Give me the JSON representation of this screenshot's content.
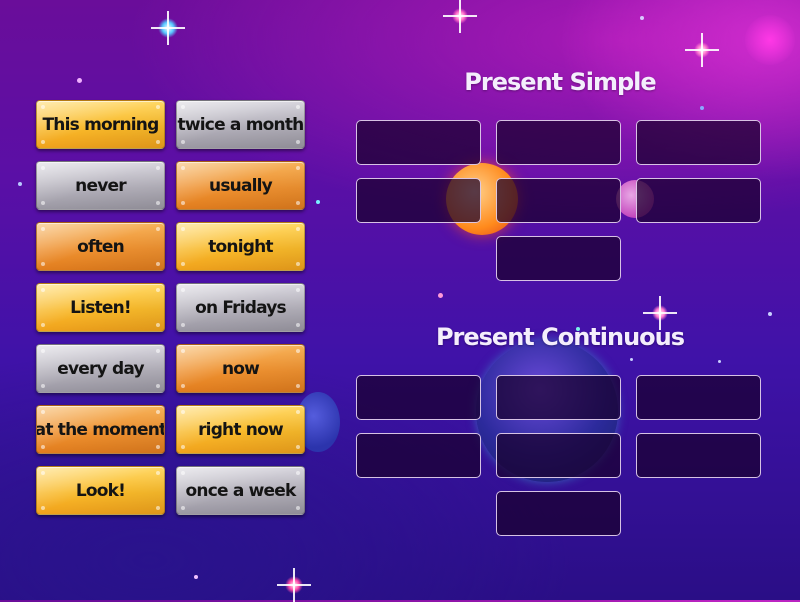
{
  "activity": {
    "type": "group-sort",
    "tiles": [
      {
        "label": "This morning",
        "color": "gold"
      },
      {
        "label": "twice a month",
        "color": "silver"
      },
      {
        "label": "never",
        "color": "silver"
      },
      {
        "label": "usually",
        "color": "orange"
      },
      {
        "label": "often",
        "color": "orange"
      },
      {
        "label": "tonight",
        "color": "gold"
      },
      {
        "label": "Listen!",
        "color": "gold"
      },
      {
        "label": "on Fridays",
        "color": "silver"
      },
      {
        "label": "every day",
        "color": "silver"
      },
      {
        "label": "now",
        "color": "orange"
      },
      {
        "label": "at the moment",
        "color": "orange"
      },
      {
        "label": "right now",
        "color": "gold"
      },
      {
        "label": "Look!",
        "color": "gold"
      },
      {
        "label": "once a week",
        "color": "silver"
      }
    ],
    "groups": [
      {
        "title": "Present Simple",
        "slot_count": 7
      },
      {
        "title": "Present Continuous",
        "slot_count": 7
      }
    ]
  },
  "colors": {
    "gold": "#f8b92a",
    "orange": "#ee9130",
    "silver": "#b3b0ba",
    "title_text": "#f4eefc",
    "slot_border": "#ebd7f5"
  }
}
